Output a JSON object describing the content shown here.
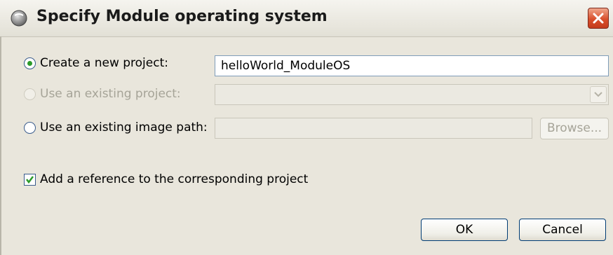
{
  "window": {
    "title": "Specify Module operating system",
    "app_icon": "eclipse-icon",
    "close_icon": "close-icon"
  },
  "options": {
    "create_new_project": {
      "label": "Create a new project:",
      "selected": true,
      "value": "helloWorld_ModuleOS"
    },
    "use_existing_project": {
      "label": "Use an existing project:",
      "enabled": false,
      "value": ""
    },
    "use_existing_image_path": {
      "label": "Use an existing image path:",
      "selected": false,
      "value": "",
      "browse_label": "Browse..."
    }
  },
  "add_reference": {
    "label": "Add a reference to the corresponding project",
    "checked": true
  },
  "buttons": {
    "ok": "OK",
    "cancel": "Cancel"
  },
  "colors": {
    "radio_dot": "#2b9a2b",
    "close": "#d94f2c",
    "focus_border": "#003c74"
  }
}
